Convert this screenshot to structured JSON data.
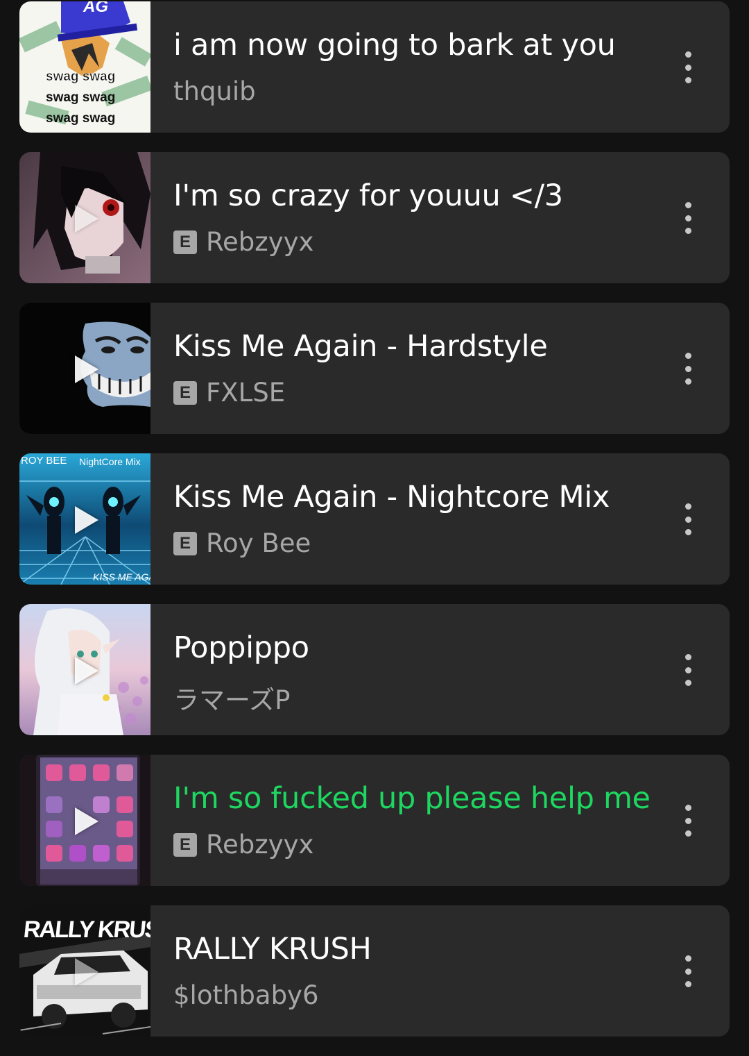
{
  "tracks": [
    {
      "title": "i am now going to bark at you",
      "artist": "thquib",
      "explicit": false,
      "playing": false,
      "art": {
        "icon": "swag-cap-art",
        "text_lines": [
          "swag swag",
          "swag swag",
          "swag swag"
        ],
        "cap_text": "AG"
      }
    },
    {
      "title": "I'm so crazy for youuu </3",
      "artist": "Rebzyyx",
      "explicit": true,
      "explicit_label": "E",
      "playing": false,
      "art": {
        "icon": "anime-girl-red-eyes-art"
      }
    },
    {
      "title": "Kiss Me Again - Hardstyle",
      "artist": "FXLSE",
      "explicit": true,
      "explicit_label": "E",
      "playing": false,
      "art": {
        "icon": "troll-face-art"
      }
    },
    {
      "title": "Kiss Me Again - Nightcore Mix",
      "artist": "Roy Bee",
      "explicit": true,
      "explicit_label": "E",
      "playing": false,
      "art": {
        "icon": "nightcore-robots-art",
        "top_text": "ROY BEE",
        "top_right_text": "NightCore Mix",
        "bottom_text": "KISS ME AGAIN"
      }
    },
    {
      "title": "Poppippo",
      "artist": "ラマーズP",
      "explicit": false,
      "playing": false,
      "art": {
        "icon": "elf-girl-flowers-art"
      }
    },
    {
      "title": "I'm so fucked up please help me",
      "artist": "Rebzyyx",
      "explicit": true,
      "explicit_label": "E",
      "playing": true,
      "art": {
        "icon": "phone-homescreen-art"
      }
    },
    {
      "title": "RALLY KRUSH",
      "artist": "$lothbaby6",
      "explicit": false,
      "playing": false,
      "art": {
        "icon": "rally-car-art",
        "top_text": "RALLY KRUSH"
      }
    }
  ],
  "colors": {
    "background": "#121212",
    "card": "#2a2a2a",
    "title": "#ffffff",
    "subtitle": "#a7a7a7",
    "playing": "#1ed760"
  }
}
